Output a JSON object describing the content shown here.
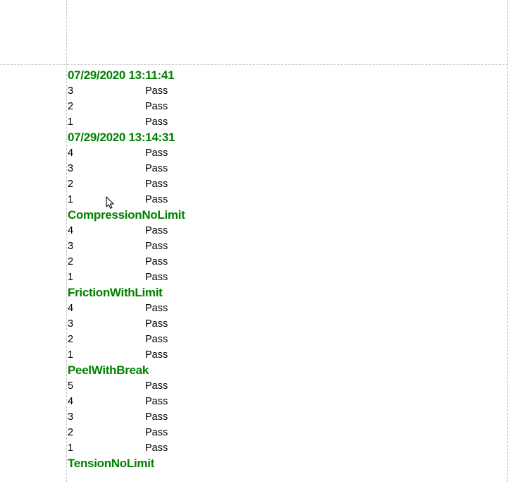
{
  "groups": [
    {
      "header": "07/29/2020 13:11:41",
      "rows": [
        {
          "idx": "3",
          "status": "Pass"
        },
        {
          "idx": "2",
          "status": "Pass"
        },
        {
          "idx": "1",
          "status": "Pass"
        }
      ]
    },
    {
      "header": "07/29/2020 13:14:31",
      "rows": [
        {
          "idx": "4",
          "status": "Pass"
        },
        {
          "idx": "3",
          "status": "Pass"
        },
        {
          "idx": "2",
          "status": "Pass"
        },
        {
          "idx": "1",
          "status": "Pass"
        }
      ]
    },
    {
      "header": "CompressionNoLimit",
      "rows": [
        {
          "idx": "4",
          "status": "Pass"
        },
        {
          "idx": "3",
          "status": "Pass"
        },
        {
          "idx": "2",
          "status": "Pass"
        },
        {
          "idx": "1",
          "status": "Pass"
        }
      ]
    },
    {
      "header": "FrictionWithLimit",
      "rows": [
        {
          "idx": "4",
          "status": "Pass"
        },
        {
          "idx": "3",
          "status": "Pass"
        },
        {
          "idx": "2",
          "status": "Pass"
        },
        {
          "idx": "1",
          "status": "Pass"
        }
      ]
    },
    {
      "header": "PeelWithBreak",
      "rows": [
        {
          "idx": "5",
          "status": "Pass"
        },
        {
          "idx": "4",
          "status": "Pass"
        },
        {
          "idx": "3",
          "status": "Pass"
        },
        {
          "idx": "2",
          "status": "Pass"
        },
        {
          "idx": "1",
          "status": "Pass"
        }
      ]
    },
    {
      "header": "TensionNoLimit",
      "rows": []
    }
  ]
}
